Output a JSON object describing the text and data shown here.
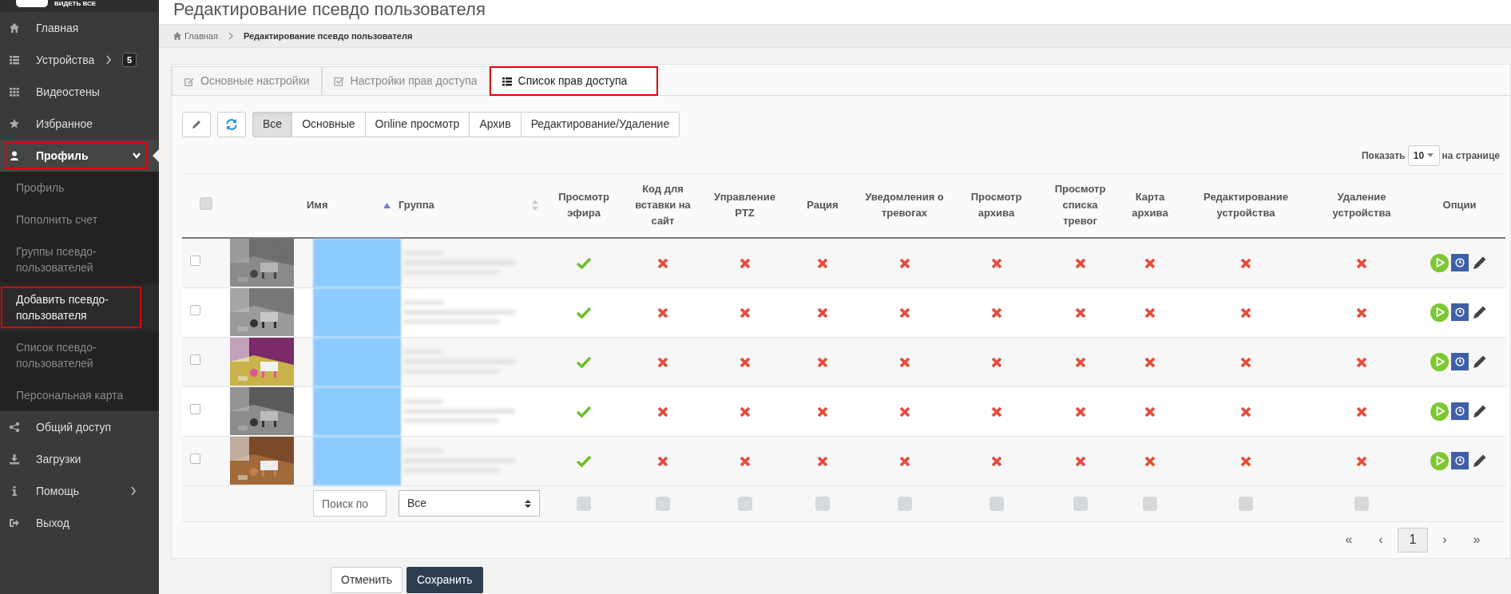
{
  "logo": {
    "tagline": "ВИДЕТЬ ВСЕ"
  },
  "sidebar": {
    "items": [
      {
        "label": "Главная",
        "selected": false
      },
      {
        "label": "Устройства",
        "selected": false,
        "expanded": false,
        "badge": "5"
      },
      {
        "label": "Видеостены",
        "selected": false
      },
      {
        "label": "Избранное",
        "selected": false
      },
      {
        "label": "Профиль",
        "selected": true,
        "expanded": true,
        "highlighted": true,
        "children": [
          {
            "label": "Профиль",
            "selected": false,
            "highlighted": false
          },
          {
            "label": "Пополнить счет",
            "selected": false,
            "highlighted": false
          },
          {
            "label": "Группы псевдо-пользователей",
            "selected": false,
            "highlighted": false
          },
          {
            "label": "Добавить псевдо-пользователя",
            "selected": true,
            "highlighted": true
          },
          {
            "label": "Список псевдо-пользователей",
            "selected": false,
            "highlighted": false
          },
          {
            "label": "Персональная карта",
            "selected": false,
            "highlighted": false
          }
        ]
      },
      {
        "label": "Общий доступ",
        "selected": false
      },
      {
        "label": "Загрузки",
        "selected": false
      },
      {
        "label": "Помощь",
        "selected": false,
        "expanded": false
      },
      {
        "label": "Выход",
        "selected": false
      }
    ]
  },
  "page_title": "Редактирование псевдо пользователя",
  "breadcrumb": [
    "Главная",
    "Редактирование псевдо пользователя"
  ],
  "tabs": [
    {
      "label": "Основные настройки",
      "selected": false,
      "highlighted": false
    },
    {
      "label": "Настройки прав доступа",
      "selected": false,
      "highlighted": false
    },
    {
      "label": "Список прав доступа",
      "selected": true,
      "highlighted": true
    }
  ],
  "filters": [
    {
      "label": "Все",
      "selected": true
    },
    {
      "label": "Основные",
      "selected": false
    },
    {
      "label": "Online просмотр",
      "selected": false
    },
    {
      "label": "Архив",
      "selected": false
    },
    {
      "label": "Редактирование/Удаление",
      "selected": false
    }
  ],
  "page_size": {
    "label": "Показать",
    "value": "10",
    "suffix": "на странице"
  },
  "table": {
    "select_all": {
      "checked": false
    },
    "columns": [
      "Имя",
      "Группа",
      "Просмотр эфира",
      "Код для вставки на сайт",
      "Управление PTZ",
      "Рация",
      "Уведомления о тревогах",
      "Просмотр архива",
      "Просмотр списка тревог",
      "Карта архива",
      "Редактирование устройства",
      "Удаление устройства",
      "Опции"
    ],
    "rows": [
      {
        "checked": false,
        "permissions": [
          true,
          false,
          false,
          false,
          false,
          false,
          false,
          false,
          false,
          false
        ]
      },
      {
        "checked": false,
        "permissions": [
          true,
          false,
          false,
          false,
          false,
          false,
          false,
          false,
          false,
          false
        ]
      },
      {
        "checked": false,
        "permissions": [
          true,
          false,
          false,
          false,
          false,
          false,
          false,
          false,
          false,
          false
        ]
      },
      {
        "checked": false,
        "permissions": [
          true,
          false,
          false,
          false,
          false,
          false,
          false,
          false,
          false,
          false
        ]
      },
      {
        "checked": false,
        "permissions": [
          true,
          false,
          false,
          false,
          false,
          false,
          false,
          false,
          false,
          false
        ]
      }
    ],
    "filter_row": {
      "search_placeholder": "Поиск по",
      "group_select": "Все",
      "column_filters": [
        {
          "checked": false
        },
        {
          "checked": false
        },
        {
          "checked": false
        },
        {
          "checked": false
        },
        {
          "checked": false
        },
        {
          "checked": false
        },
        {
          "checked": false
        },
        {
          "checked": false
        },
        {
          "checked": false
        },
        {
          "checked": false
        }
      ]
    }
  },
  "pagination": [
    {
      "label": "«",
      "selected": false
    },
    {
      "label": "‹",
      "selected": false
    },
    {
      "label": "1",
      "selected": true
    },
    {
      "label": "›",
      "selected": false
    },
    {
      "label": "»",
      "selected": false
    }
  ],
  "footer_buttons": [
    {
      "label": "Отменить",
      "kind": "secondary"
    },
    {
      "label": "Сохранить",
      "kind": "primary"
    }
  ]
}
